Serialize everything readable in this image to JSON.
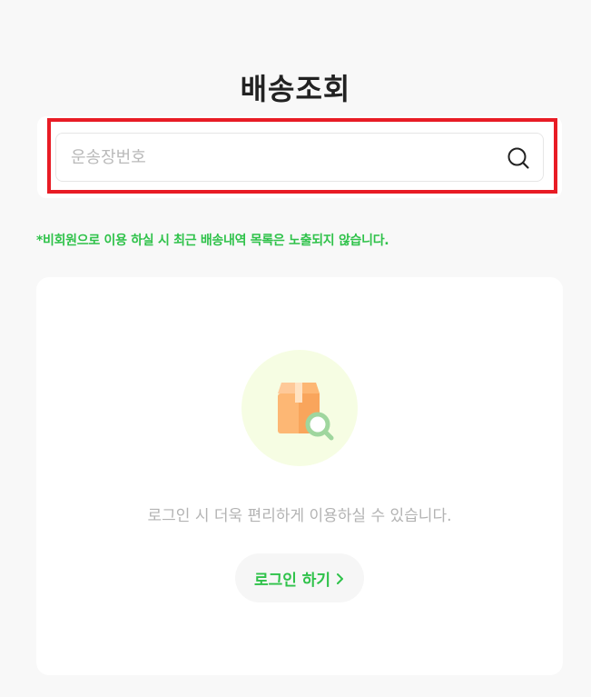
{
  "header": {
    "title": "배송조회"
  },
  "search": {
    "placeholder": "운송장번호",
    "value": "",
    "icon": "search-icon"
  },
  "notice": {
    "text": "*비회원으로 이용 하실 시 최근 배송내역 목록은 노출되지 않습니다."
  },
  "empty_state": {
    "illustration_icon": "package-search-icon",
    "message": "로그인 시 더욱 편리하게 이용하실 수 있습니다.",
    "login_button_label": "로그인 하기",
    "login_button_icon": "chevron-right-icon"
  },
  "colors": {
    "accent_green": "#2fc24a",
    "highlight_red": "#e81c25",
    "illustration_circle": "#f6fde3",
    "box_orange": "#fdb774",
    "magnifier_green": "#9fd69e"
  }
}
